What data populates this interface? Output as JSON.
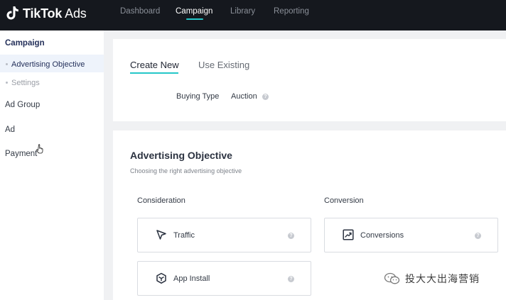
{
  "app": {
    "brand_name": "TikTok",
    "brand_suffix": "Ads",
    "accent_color": "#25c7c9"
  },
  "nav": {
    "items": [
      {
        "label": "Dashboard",
        "active": false
      },
      {
        "label": "Campaign",
        "active": true
      },
      {
        "label": "Library",
        "active": false
      },
      {
        "label": "Reporting",
        "active": false
      }
    ]
  },
  "sidebar": {
    "campaign": "Campaign",
    "sub_items": [
      {
        "label": "Advertising Objective",
        "active": true
      },
      {
        "label": "Settings",
        "active": false
      }
    ],
    "ad_group": "Ad Group",
    "ad": "Ad",
    "payment": "Payment"
  },
  "tabs": {
    "create_new": "Create New",
    "use_existing": "Use Existing"
  },
  "buying_type": {
    "label": "Buying Type",
    "value": "Auction"
  },
  "objective": {
    "title": "Advertising Objective",
    "subtitle": "Choosing the right advertising objective",
    "consideration": {
      "label": "Consideration",
      "options": [
        {
          "label": "Traffic",
          "icon": "cursor-arrow-icon"
        },
        {
          "label": "App Install",
          "icon": "app-cube-icon"
        }
      ]
    },
    "conversion": {
      "label": "Conversion",
      "options": [
        {
          "label": "Conversions",
          "icon": "trend-chart-icon"
        }
      ]
    }
  },
  "watermark": {
    "text": "投大大出海营销"
  }
}
